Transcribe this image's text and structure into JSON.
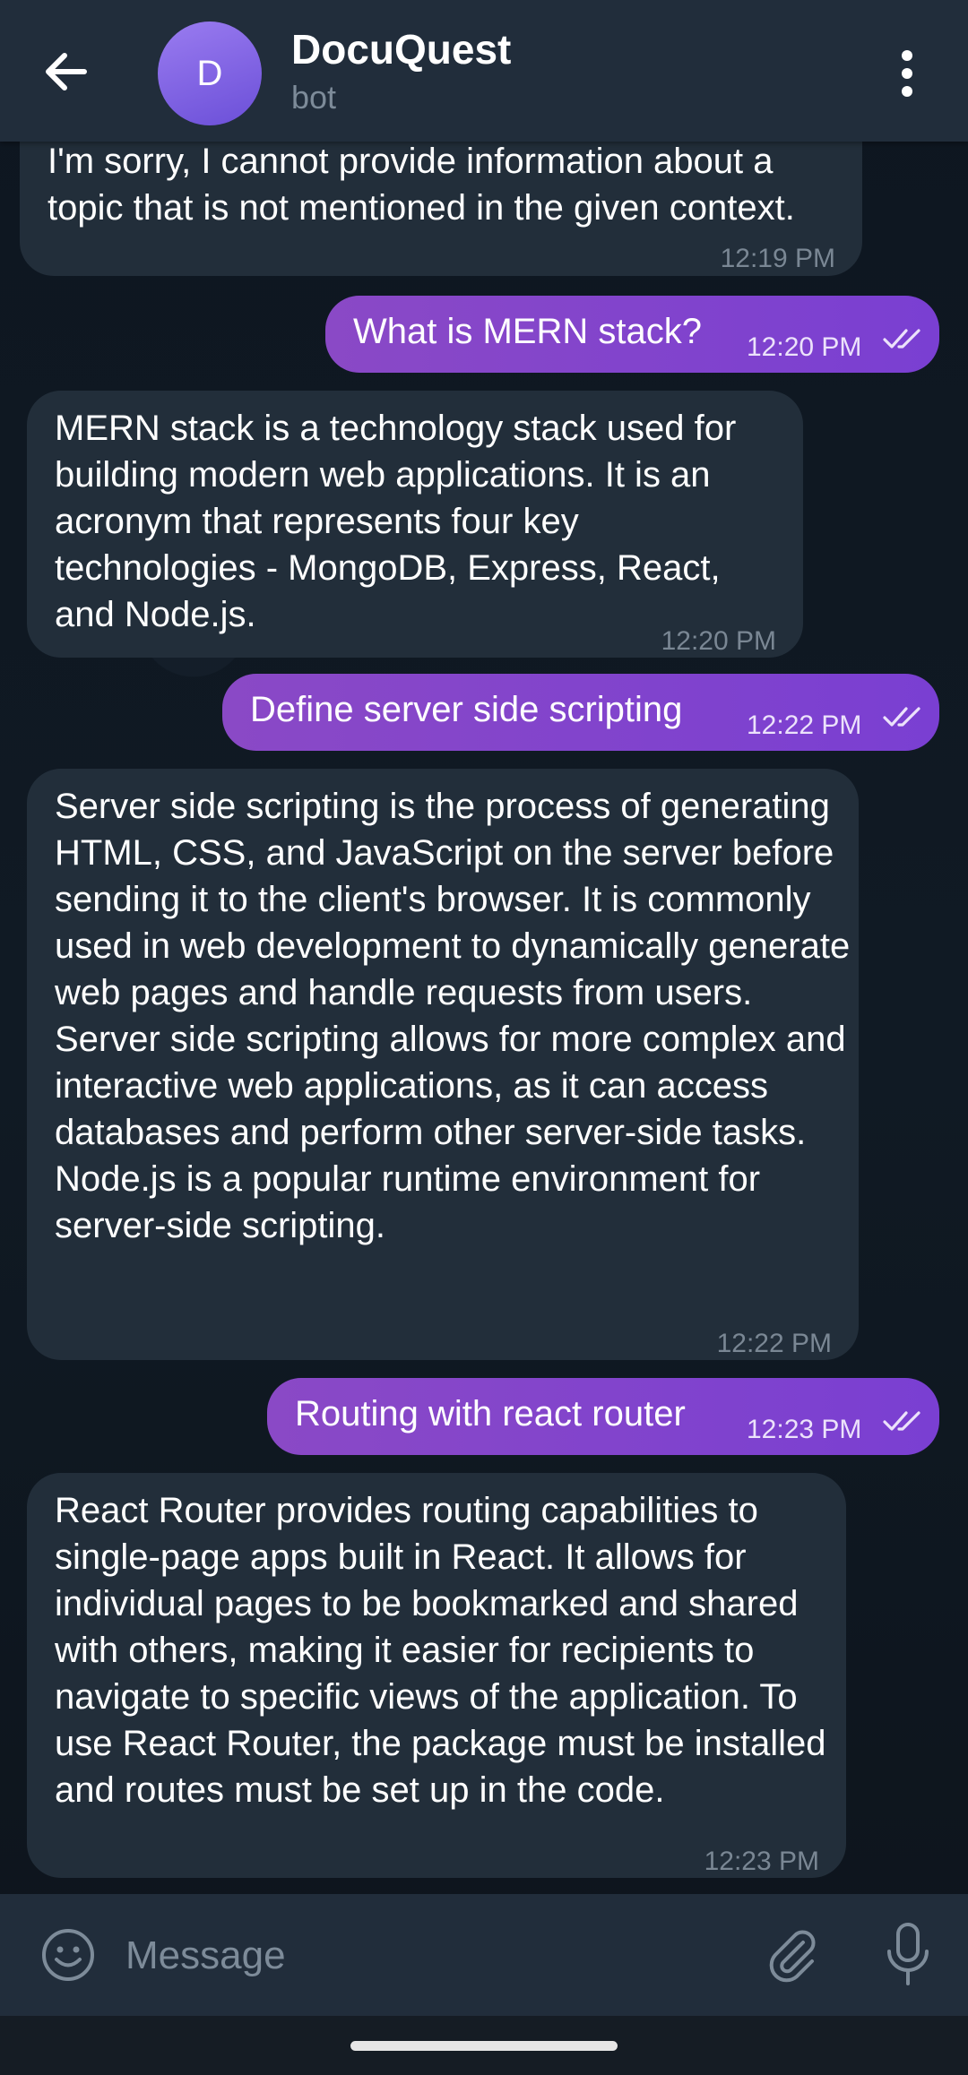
{
  "header": {
    "avatar_letter": "D",
    "title": "DocuQuest",
    "subtitle": "bot"
  },
  "messages": [
    {
      "direction": "in",
      "text": "I'm sorry, I cannot provide information about a topic that is not mentioned in the given context.",
      "time": "12:19 PM"
    },
    {
      "direction": "out",
      "text": "What is MERN stack?",
      "time": "12:20 PM",
      "status": "read"
    },
    {
      "direction": "in",
      "text": "MERN stack is a technology stack used for building modern web applications. It is an acronym that represents four key technologies - MongoDB, Express, React, and Node.js.",
      "time": "12:20 PM"
    },
    {
      "direction": "out",
      "text": "Define server side scripting",
      "time": "12:22 PM",
      "status": "read"
    },
    {
      "direction": "in",
      "text": "Server side scripting is the process of generating HTML, CSS, and JavaScript on the server before sending it to the client's browser. It is commonly used in web development to dynamically generate web pages and handle requests from users. Server side scripting allows for more complex and interactive web applications, as it can access databases and perform other server-side tasks. Node.js is a popular runtime environment for server-side scripting.",
      "time": "12:22 PM"
    },
    {
      "direction": "out",
      "text": "Routing with react router",
      "time": "12:23 PM",
      "status": "read"
    },
    {
      "direction": "in",
      "text": "React Router provides routing capabilities to single-page apps built in React. It allows for individual pages to be bookmarked and shared with others, making it easier for recipients to navigate to specific views of the application. To use React Router, the package must be installed and routes must be set up in the code.",
      "time": "12:23 PM"
    }
  ],
  "composer": {
    "placeholder": "Message"
  },
  "icons": {
    "back": "arrow-left-icon",
    "menu": "more-vert-icon",
    "emoji": "smile-icon",
    "attach": "paperclip-icon",
    "mic": "microphone-icon",
    "read": "double-check-icon"
  },
  "colors": {
    "header": "#212d3b",
    "incoming_bubble": "#222e3a",
    "outgoing_bubble": "#7b42d0",
    "accent_avatar": "#7a5ce6",
    "muted_text": "#7d8b99"
  }
}
